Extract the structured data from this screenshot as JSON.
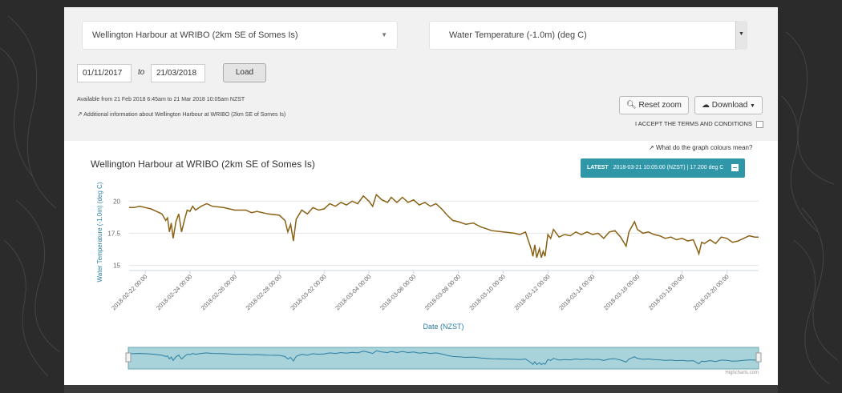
{
  "site_select": {
    "value": "Wellington Harbour at WRIBO (2km SE of Somes Is)"
  },
  "param_select": {
    "value": "Water Temperature (-1.0m) (deg C)"
  },
  "date_range": {
    "from": "01/11/2017",
    "to_label": "to",
    "to": "21/03/2018"
  },
  "load_label": "Load",
  "available_text": "Available from 21 Feb 2018 6:45am to 21 Mar 2018 10:05am NZST",
  "additional_info": "Additional information about Wellington Harbour at WRIBO (2km SE of Somes Is)",
  "reset_zoom_label": "Reset zoom",
  "download_label": "Download",
  "terms_label": "I ACCEPT THE TERMS AND CONDITIONS",
  "colours_link": "What do the graph colours mean?",
  "latest": {
    "label": "LATEST",
    "text": "2018-03-21 10:05:00 (NZST) | 17.200 deg C"
  },
  "credit": "Highcharts.com",
  "colors": {
    "line": "#8a6215",
    "accent": "#2f97a8",
    "navigator_fill": "#a8d3da",
    "navigator_line": "#2a7da0"
  },
  "chart_data": {
    "type": "line",
    "title": "Wellington Harbour at WRIBO (2km SE of Somes Is)",
    "xlabel": "Date (NZST)",
    "ylabel": "Water Temperature (-1.0m) (deg C)",
    "x_ticks": [
      "2018-02-22 00:00",
      "2018-02-24 00:00",
      "2018-02-26 00:00",
      "2018-02-28 00:00",
      "2018-03-02 00:00",
      "2018-03-04 00:00",
      "2018-03-06 00:00",
      "2018-03-08 00:00",
      "2018-03-10 00:00",
      "2018-03-12 00:00",
      "2018-03-14 00:00",
      "2018-03-16 00:00",
      "2018-03-18 00:00",
      "2018-03-20 00:00"
    ],
    "y_ticks": [
      "15",
      "17.5",
      "20"
    ],
    "ylim": [
      14.6,
      21.2
    ],
    "xlim": [
      "2018-02-21 06:45",
      "2018-03-21 10:05"
    ],
    "grid": true,
    "series": [
      {
        "points": [
          [
            "2018-02-21 06:45",
            19.5
          ],
          [
            "2018-02-21 12:00",
            19.5
          ],
          [
            "2018-02-21 18:00",
            19.6
          ],
          [
            "2018-02-22 00:00",
            19.5
          ],
          [
            "2018-02-22 06:00",
            19.4
          ],
          [
            "2018-02-22 12:00",
            19.2
          ],
          [
            "2018-02-22 18:00",
            19.0
          ],
          [
            "2018-02-22 22:00",
            18.5
          ],
          [
            "2018-02-23 00:00",
            18.7
          ],
          [
            "2018-02-23 02:00",
            17.6
          ],
          [
            "2018-02-23 04:00",
            18.3
          ],
          [
            "2018-02-23 06:00",
            17.1
          ],
          [
            "2018-02-23 09:00",
            18.4
          ],
          [
            "2018-02-23 12:00",
            19.0
          ],
          [
            "2018-02-23 15:00",
            17.6
          ],
          [
            "2018-02-23 18:00",
            18.5
          ],
          [
            "2018-02-23 21:00",
            19.3
          ],
          [
            "2018-02-24 00:00",
            19.2
          ],
          [
            "2018-02-24 03:00",
            19.6
          ],
          [
            "2018-02-24 06:00",
            19.3
          ],
          [
            "2018-02-24 12:00",
            19.6
          ],
          [
            "2018-02-24 18:00",
            19.8
          ],
          [
            "2018-02-25 00:00",
            19.6
          ],
          [
            "2018-02-25 12:00",
            19.5
          ],
          [
            "2018-02-26 00:00",
            19.3
          ],
          [
            "2018-02-26 12:00",
            19.3
          ],
          [
            "2018-02-26 18:00",
            19.1
          ],
          [
            "2018-02-27 00:00",
            19.2
          ],
          [
            "2018-02-27 12:00",
            19.0
          ],
          [
            "2018-02-28 00:00",
            18.9
          ],
          [
            "2018-02-28 06:00",
            18.5
          ],
          [
            "2018-02-28 09:00",
            17.6
          ],
          [
            "2018-02-28 12:00",
            18.2
          ],
          [
            "2018-02-28 15:00",
            16.9
          ],
          [
            "2018-02-28 18:00",
            18.6
          ],
          [
            "2018-03-01 00:00",
            19.3
          ],
          [
            "2018-03-01 06:00",
            19.0
          ],
          [
            "2018-03-01 12:00",
            19.5
          ],
          [
            "2018-03-01 18:00",
            19.3
          ],
          [
            "2018-03-02 00:00",
            19.4
          ],
          [
            "2018-03-02 06:00",
            19.8
          ],
          [
            "2018-03-02 12:00",
            19.6
          ],
          [
            "2018-03-02 18:00",
            19.9
          ],
          [
            "2018-03-03 00:00",
            19.7
          ],
          [
            "2018-03-03 06:00",
            20.0
          ],
          [
            "2018-03-03 12:00",
            19.8
          ],
          [
            "2018-03-03 18:00",
            20.4
          ],
          [
            "2018-03-04 00:00",
            20.0
          ],
          [
            "2018-03-04 04:00",
            19.6
          ],
          [
            "2018-03-04 08:00",
            20.5
          ],
          [
            "2018-03-04 14:00",
            20.1
          ],
          [
            "2018-03-04 20:00",
            19.9
          ],
          [
            "2018-03-05 00:00",
            20.3
          ],
          [
            "2018-03-05 06:00",
            19.9
          ],
          [
            "2018-03-05 12:00",
            20.3
          ],
          [
            "2018-03-05 18:00",
            19.9
          ],
          [
            "2018-03-06 00:00",
            20.1
          ],
          [
            "2018-03-06 06:00",
            19.7
          ],
          [
            "2018-03-06 12:00",
            19.9
          ],
          [
            "2018-03-06 18:00",
            19.6
          ],
          [
            "2018-03-07 00:00",
            19.8
          ],
          [
            "2018-03-07 06:00",
            19.4
          ],
          [
            "2018-03-07 12:00",
            18.9
          ],
          [
            "2018-03-07 18:00",
            18.5
          ],
          [
            "2018-03-08 00:00",
            18.4
          ],
          [
            "2018-03-08 08:00",
            18.2
          ],
          [
            "2018-03-08 16:00",
            18.3
          ],
          [
            "2018-03-09 00:00",
            18.0
          ],
          [
            "2018-03-09 12:00",
            17.7
          ],
          [
            "2018-03-10 00:00",
            17.6
          ],
          [
            "2018-03-10 12:00",
            17.5
          ],
          [
            "2018-03-10 18:00",
            17.4
          ],
          [
            "2018-03-11 00:00",
            17.6
          ],
          [
            "2018-03-11 06:00",
            16.3
          ],
          [
            "2018-03-11 08:00",
            15.7
          ],
          [
            "2018-03-11 10:00",
            16.6
          ],
          [
            "2018-03-11 12:00",
            15.6
          ],
          [
            "2018-03-11 15:00",
            16.3
          ],
          [
            "2018-03-11 17:00",
            15.6
          ],
          [
            "2018-03-11 19:00",
            16.1
          ],
          [
            "2018-03-11 21:00",
            15.7
          ],
          [
            "2018-03-12 00:00",
            17.4
          ],
          [
            "2018-03-12 03:00",
            17.1
          ],
          [
            "2018-03-12 06:00",
            17.8
          ],
          [
            "2018-03-12 12:00",
            17.2
          ],
          [
            "2018-03-12 18:00",
            17.4
          ],
          [
            "2018-03-13 00:00",
            17.3
          ],
          [
            "2018-03-13 06:00",
            17.6
          ],
          [
            "2018-03-13 12:00",
            17.4
          ],
          [
            "2018-03-13 18:00",
            17.6
          ],
          [
            "2018-03-14 00:00",
            17.4
          ],
          [
            "2018-03-14 06:00",
            17.5
          ],
          [
            "2018-03-14 12:00",
            17.1
          ],
          [
            "2018-03-14 18:00",
            17.6
          ],
          [
            "2018-03-15 00:00",
            17.7
          ],
          [
            "2018-03-15 06:00",
            17.2
          ],
          [
            "2018-03-15 12:00",
            16.5
          ],
          [
            "2018-03-15 15:00",
            17.6
          ],
          [
            "2018-03-15 21:00",
            18.4
          ],
          [
            "2018-03-16 00:00",
            17.8
          ],
          [
            "2018-03-16 06:00",
            17.5
          ],
          [
            "2018-03-16 12:00",
            17.6
          ],
          [
            "2018-03-16 18:00",
            17.4
          ],
          [
            "2018-03-17 00:00",
            17.3
          ],
          [
            "2018-03-17 06:00",
            17.1
          ],
          [
            "2018-03-17 12:00",
            17.2
          ],
          [
            "2018-03-17 18:00",
            17.0
          ],
          [
            "2018-03-18 00:00",
            17.1
          ],
          [
            "2018-03-18 06:00",
            16.9
          ],
          [
            "2018-03-18 12:00",
            17.0
          ],
          [
            "2018-03-18 16:00",
            16.3
          ],
          [
            "2018-03-18 18:00",
            15.9
          ],
          [
            "2018-03-18 21:00",
            16.8
          ],
          [
            "2018-03-19 00:00",
            16.7
          ],
          [
            "2018-03-19 06:00",
            17.0
          ],
          [
            "2018-03-19 12:00",
            16.7
          ],
          [
            "2018-03-19 18:00",
            17.2
          ],
          [
            "2018-03-20 00:00",
            17.1
          ],
          [
            "2018-03-20 06:00",
            16.8
          ],
          [
            "2018-03-20 12:00",
            16.9
          ],
          [
            "2018-03-20 18:00",
            17.1
          ],
          [
            "2018-03-21 00:00",
            17.3
          ],
          [
            "2018-03-21 06:00",
            17.2
          ],
          [
            "2018-03-21 10:05",
            17.2
          ]
        ]
      }
    ]
  }
}
